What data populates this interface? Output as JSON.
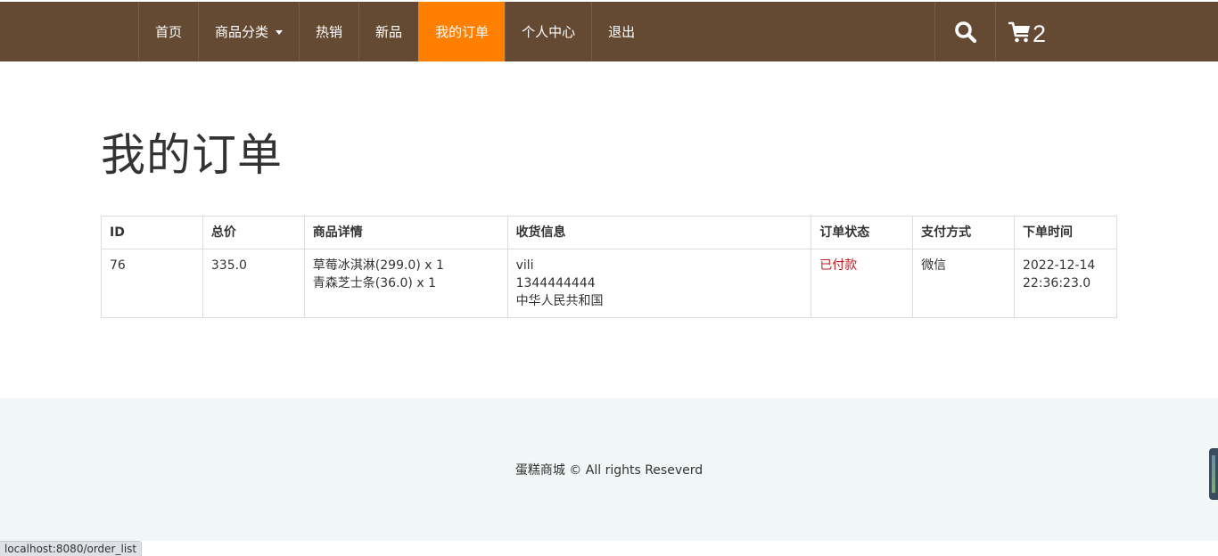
{
  "nav": {
    "items": [
      {
        "label": "首页"
      },
      {
        "label": "商品分类"
      },
      {
        "label": "热销"
      },
      {
        "label": "新品"
      },
      {
        "label": "我的订单"
      },
      {
        "label": "个人中心"
      },
      {
        "label": "退出"
      }
    ],
    "active": "我的订单",
    "cart_count": "2",
    "icons": [
      "search-icon",
      "cart-icon",
      "chevron-down-icon"
    ]
  },
  "main": {
    "title": "我的订单",
    "table": {
      "headers": [
        "ID",
        "总价",
        "商品详情",
        "收货信息",
        "订单状态",
        "支付方式",
        "下单时间"
      ],
      "rows": [
        {
          "id": "76",
          "total": "335.0",
          "items": [
            "草莓冰淇淋(299.0) x 1",
            "青森芝士条(36.0) x 1"
          ],
          "shipping": [
            "vili",
            "1344444444",
            "中华人民共和国"
          ],
          "status": "已付款",
          "payment": "微信",
          "time": [
            "2022-12-14",
            "22:36:23.0"
          ]
        }
      ]
    }
  },
  "footer": {
    "text": "蛋糕商城 © All rights Reseverd"
  },
  "browser": {
    "status_url": "localhost:8080/order_list"
  },
  "colors": {
    "navbar": "#654a33",
    "active": "#ff7f00",
    "footer_bg": "#f1f6f6",
    "status_paid": "#c7171b"
  }
}
